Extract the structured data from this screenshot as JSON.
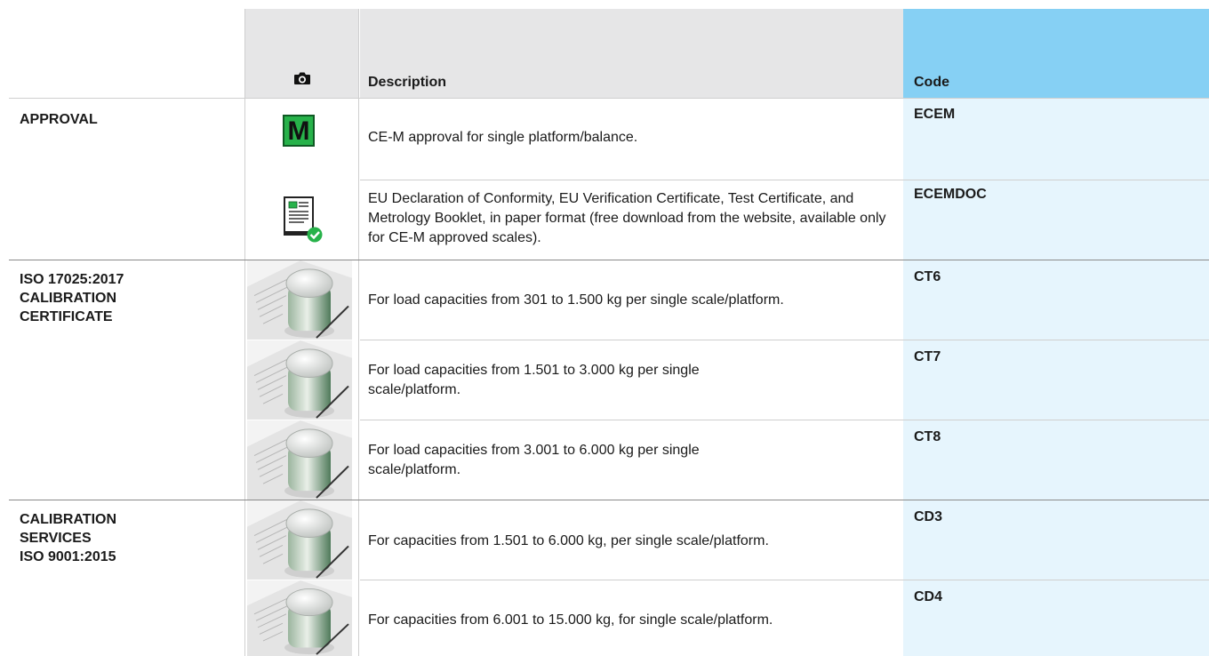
{
  "header": {
    "photo_icon": "camera-icon",
    "description_label": "Description",
    "code_label": "Code"
  },
  "colors": {
    "header_gray": "#e6e6e7",
    "code_header": "#86d0f4",
    "code_column": "#e6f5fd",
    "approval_green": "#27b24a"
  },
  "sections": [
    {
      "title": "APPROVAL"
    },
    {
      "title": "ISO 17025:2017\nCALIBRATION\nCERTIFICATE"
    },
    {
      "title": "CALIBRATION\nSERVICES\nISO 9001:2015"
    }
  ],
  "rows": [
    {
      "icon": "ce-m-badge-icon",
      "badge_letter": "M",
      "description": "CE-M approval for single platform/balance.",
      "code": "ECEM"
    },
    {
      "icon": "certificate-check-icon",
      "description": "EU Declaration of Conformity, EU Verification Certificate, Test Certificate, and Metrology Booklet, in paper format (free download from the website, available only for CE-M approved scales).",
      "code": "ECEMDOC"
    },
    {
      "icon": "calibration-weight-photo",
      "description": "For load capacities from 301 to 1.500 kg per single scale/platform.",
      "code": "CT6"
    },
    {
      "icon": "calibration-weight-photo",
      "description": "For load capacities from 1.501 to 3.000 kg per single scale/platform.",
      "code": "CT7"
    },
    {
      "icon": "calibration-weight-photo",
      "description": "For load capacities from 3.001 to 6.000 kg per single scale/platform.",
      "code": "CT8"
    },
    {
      "icon": "calibration-weight-photo",
      "description": "For capacities from 1.501 to 6.000 kg, per single scale/platform.",
      "code": "CD3"
    },
    {
      "icon": "calibration-weight-photo",
      "description": "For capacities from 6.001 to 15.000 kg, for single scale/platform.",
      "code": "CD4"
    }
  ]
}
